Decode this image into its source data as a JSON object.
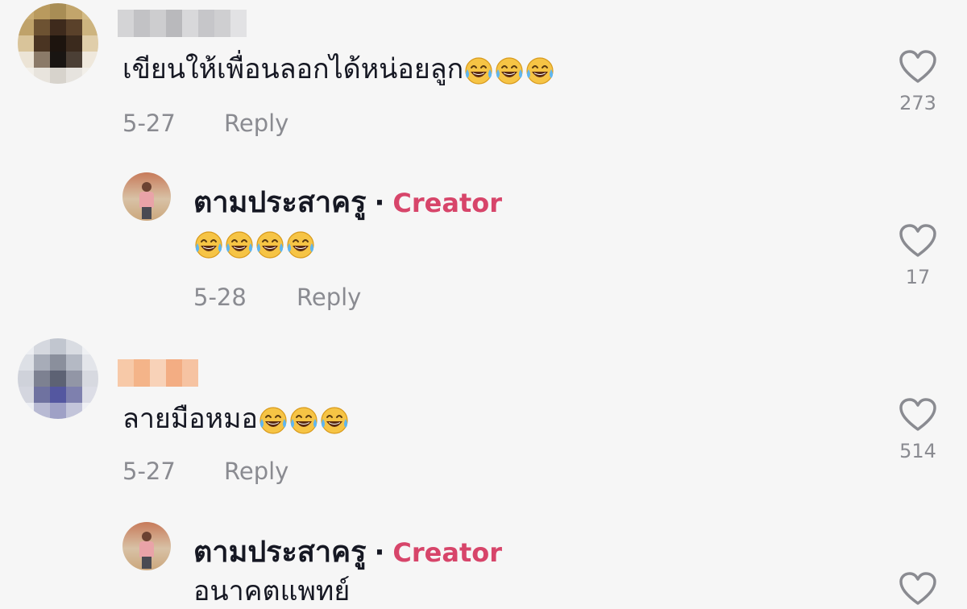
{
  "comments": [
    {
      "text": "เขียนให้เพื่อนลอกได้หน่อยลูก",
      "emoji_count": 3,
      "date": "5-27",
      "reply_label": "Reply",
      "likes": "273"
    },
    {
      "author": "ตามประสาครู",
      "badge": "Creator",
      "separator": "·",
      "text": "",
      "emoji_count": 4,
      "date": "5-28",
      "reply_label": "Reply",
      "likes": "17"
    },
    {
      "text": "ลายมือหมอ",
      "emoji_count": 3,
      "date": "5-27",
      "reply_label": "Reply",
      "likes": "514"
    },
    {
      "author": "ตามประสาครู",
      "badge": "Creator",
      "separator": "·",
      "text": "อนาคตแพทย์"
    }
  ],
  "emoji_name": "face-with-tears-of-joy",
  "colors": {
    "background": "#f6f6f6",
    "creator_badge": "#d7456a",
    "muted_text": "#8a8b91"
  }
}
